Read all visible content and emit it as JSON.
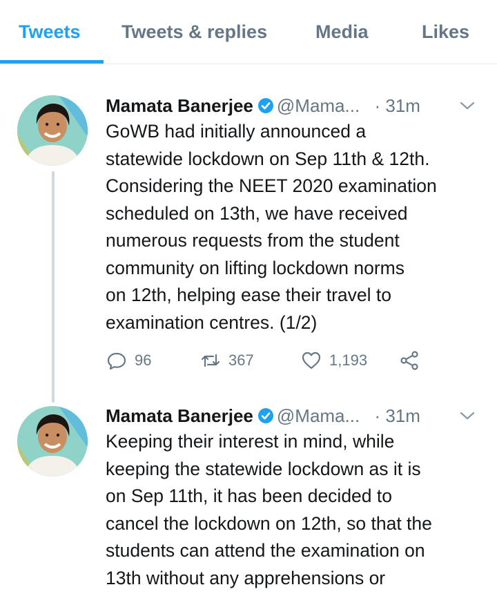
{
  "tabs": [
    {
      "label": "Tweets",
      "active": true
    },
    {
      "label": "Tweets & replies",
      "active": false
    },
    {
      "label": "Media",
      "active": false
    },
    {
      "label": "Likes",
      "active": false
    }
  ],
  "colors": {
    "accent": "#1da1f2",
    "secondary_text": "#657786",
    "verified": "#1da1f2",
    "thread_line": "#cfd9de"
  },
  "tweets": [
    {
      "name": "Mamata Banerjee",
      "handle": "@Mama...",
      "time": "· 31m",
      "lines": [
        "GoWB had initially announced a",
        "statewide lockdown on Sep 11th & 12th.",
        "Considering the NEET 2020 examination",
        "scheduled on 13th, we have received",
        "numerous requests from the student",
        "community on lifting lockdown norms",
        "on 12th, helping ease their travel to",
        "examination centres. (1/2)"
      ],
      "replies": "96",
      "retweets": "367",
      "likes": "1,193",
      "icons": [
        "reply-icon",
        "retweet-icon",
        "like-icon",
        "share-icon"
      ]
    },
    {
      "name": "Mamata Banerjee",
      "handle": "@Mama...",
      "time": "· 31m",
      "lines": [
        "Keeping their interest in mind, while",
        "keeping the statewide lockdown as it is",
        "on Sep 11th, it has been decided to",
        "cancel the lockdown on 12th, so that the",
        "students can attend the examination on",
        "13th without any apprehensions or"
      ]
    }
  ]
}
